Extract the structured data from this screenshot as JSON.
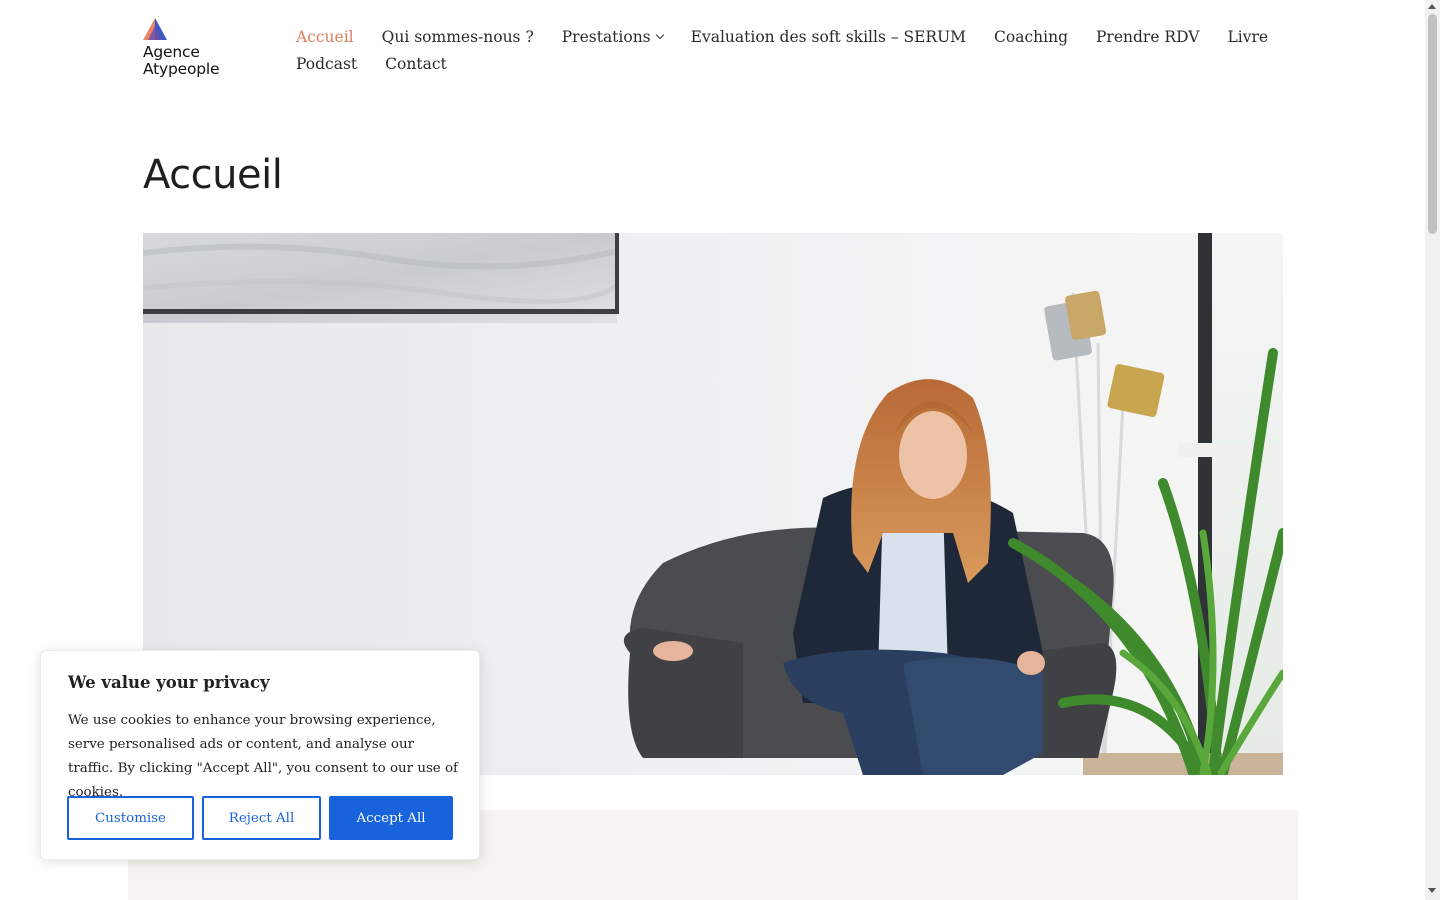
{
  "header": {
    "logo": {
      "line1": "Agence",
      "line2": "Atypeople"
    },
    "nav": {
      "row1": [
        {
          "label": "Accueil",
          "active": true
        },
        {
          "label": "Qui sommes-nous ?"
        },
        {
          "label": "Prestations",
          "has_dropdown": true
        },
        {
          "label": "Evaluation des soft skills – SERUM"
        },
        {
          "label": "Coaching"
        },
        {
          "label": "Prendre RDV"
        },
        {
          "label": "Livre"
        }
      ],
      "row2": [
        {
          "label": "Podcast"
        },
        {
          "label": "Contact"
        }
      ]
    }
  },
  "main": {
    "title": "Accueil"
  },
  "cookie_banner": {
    "title": "We value your privacy",
    "text": "We use cookies to enhance your browsing experience, serve personalised ads or content, and analyse our traffic. By clicking \"Accept All\", you consent to our use of cookies.",
    "buttons": {
      "customise": "Customise",
      "reject": "Reject All",
      "accept": "Accept All"
    }
  },
  "colors": {
    "accent_active_nav": "#e07a5f",
    "button_blue": "#1863dc",
    "beige_section": "#f4f3ef"
  }
}
